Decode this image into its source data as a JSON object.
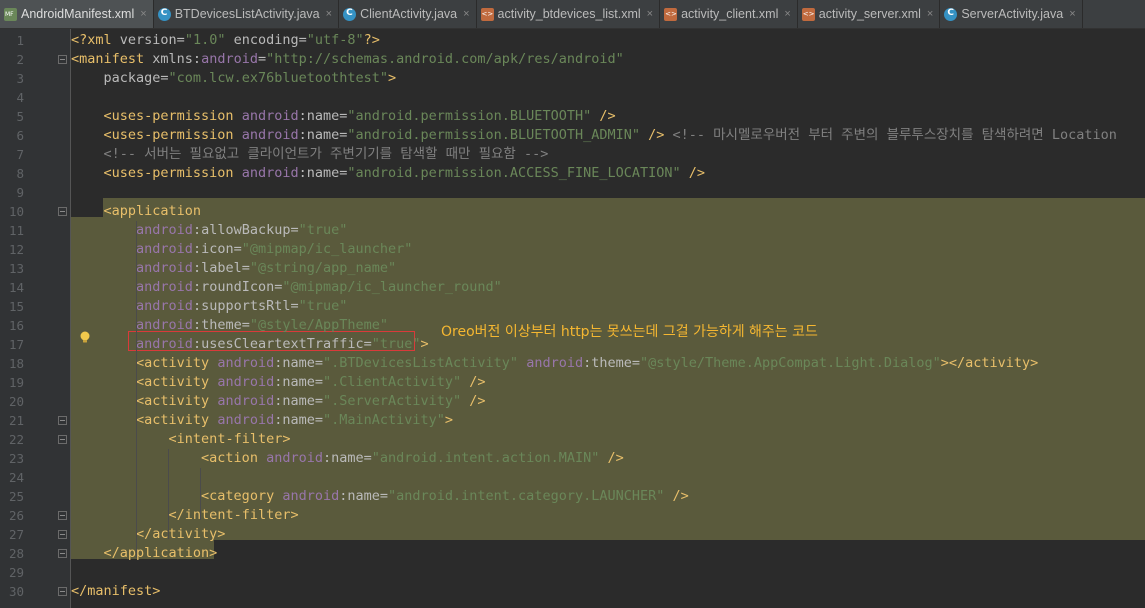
{
  "tabs": [
    {
      "label": "AndroidManifest.xml",
      "type": "manifest",
      "active": true
    },
    {
      "label": "BTDevicesListActivity.java",
      "type": "java",
      "active": false
    },
    {
      "label": "ClientActivity.java",
      "type": "java",
      "active": false
    },
    {
      "label": "activity_btdevices_list.xml",
      "type": "layout",
      "active": false
    },
    {
      "label": "activity_client.xml",
      "type": "layout",
      "active": false
    },
    {
      "label": "activity_server.xml",
      "type": "layout",
      "active": false
    },
    {
      "label": "ServerActivity.java",
      "type": "java",
      "active": false
    }
  ],
  "colors": {
    "background": "#2b2b2b",
    "highlight": "#5a5a3c",
    "annotation": "#f5b731",
    "red_box": "#d93a3a"
  },
  "annotation_text": "Oreo버전 이상부터 http는 못쓰는데 그걸 가능하게 해주는 코드",
  "lines": [
    {
      "n": "1",
      "segments": [
        [
          "tag",
          "<?xml "
        ],
        [
          "attr",
          "version="
        ],
        [
          "val",
          "\"1.0\""
        ],
        [
          "attr",
          " encoding="
        ],
        [
          "val",
          "\"utf-8\""
        ],
        [
          "tag",
          "?>"
        ]
      ]
    },
    {
      "n": "2",
      "segments": [
        [
          "tag",
          "<manifest "
        ],
        [
          "attr",
          "xmlns:"
        ],
        [
          "ns",
          "android"
        ],
        [
          "attr",
          "="
        ],
        [
          "val",
          "\"http://schemas.android.com/apk/res/android\""
        ]
      ]
    },
    {
      "n": "3",
      "segments": [
        [
          "plain",
          "    "
        ],
        [
          "attr",
          "package="
        ],
        [
          "val",
          "\"com.lcw.ex76bluetoothtest\""
        ],
        [
          "tag",
          ">"
        ]
      ]
    },
    {
      "n": "4",
      "segments": []
    },
    {
      "n": "5",
      "segments": [
        [
          "plain",
          "    "
        ],
        [
          "tag",
          "<uses-permission "
        ],
        [
          "ns",
          "android"
        ],
        [
          "attr",
          ":name="
        ],
        [
          "val",
          "\"android.permission.BLUETOOTH\""
        ],
        [
          "tag",
          " />"
        ]
      ]
    },
    {
      "n": "6",
      "segments": [
        [
          "plain",
          "    "
        ],
        [
          "tag",
          "<uses-permission "
        ],
        [
          "ns",
          "android"
        ],
        [
          "attr",
          ":name="
        ],
        [
          "val",
          "\"android.permission.BLUETOOTH_ADMIN\""
        ],
        [
          "tag",
          " />"
        ],
        [
          "cmt",
          " <!-- 마시멜로우버전 부터 주변의 블루투스장치를 탐색하려면 Location"
        ]
      ]
    },
    {
      "n": "7",
      "segments": [
        [
          "cmt",
          "    <!-- 서버는 필요없고 클라이언트가 주변기기를 탐색할 때만 필요함 -->"
        ]
      ]
    },
    {
      "n": "8",
      "segments": [
        [
          "plain",
          "    "
        ],
        [
          "tag",
          "<uses-permission "
        ],
        [
          "ns",
          "android"
        ],
        [
          "attr",
          ":name="
        ],
        [
          "val",
          "\"android.permission.ACCESS_FINE_LOCATION\""
        ],
        [
          "tag",
          " />"
        ]
      ]
    },
    {
      "n": "9",
      "segments": []
    },
    {
      "n": "10",
      "segments": [
        [
          "plain",
          "    "
        ],
        [
          "tag",
          "<application"
        ]
      ]
    },
    {
      "n": "11",
      "segments": [
        [
          "plain",
          "        "
        ],
        [
          "ns",
          "android"
        ],
        [
          "attr",
          ":allowBackup="
        ],
        [
          "val",
          "\"true\""
        ]
      ]
    },
    {
      "n": "12",
      "segments": [
        [
          "plain",
          "        "
        ],
        [
          "ns",
          "android"
        ],
        [
          "attr",
          ":icon="
        ],
        [
          "val",
          "\"@mipmap/ic_launcher\""
        ]
      ]
    },
    {
      "n": "13",
      "segments": [
        [
          "plain",
          "        "
        ],
        [
          "ns",
          "android"
        ],
        [
          "attr",
          ":label="
        ],
        [
          "val",
          "\"@string/app_name\""
        ]
      ]
    },
    {
      "n": "14",
      "segments": [
        [
          "plain",
          "        "
        ],
        [
          "ns",
          "android"
        ],
        [
          "attr",
          ":roundIcon="
        ],
        [
          "val",
          "\"@mipmap/ic_launcher_round\""
        ]
      ]
    },
    {
      "n": "15",
      "segments": [
        [
          "plain",
          "        "
        ],
        [
          "ns",
          "android"
        ],
        [
          "attr",
          ":supportsRtl="
        ],
        [
          "val",
          "\"true\""
        ]
      ]
    },
    {
      "n": "16",
      "segments": [
        [
          "plain",
          "        "
        ],
        [
          "ns",
          "android"
        ],
        [
          "attr",
          ":theme="
        ],
        [
          "val",
          "\"@style/AppTheme\""
        ]
      ]
    },
    {
      "n": "17",
      "segments": [
        [
          "plain",
          "        "
        ],
        [
          "ns",
          "android"
        ],
        [
          "attr",
          ":usesCleartextTraffic="
        ],
        [
          "val",
          "\"true\""
        ],
        [
          "tag",
          ">"
        ]
      ]
    },
    {
      "n": "18",
      "segments": [
        [
          "plain",
          "        "
        ],
        [
          "tag",
          "<activity "
        ],
        [
          "ns",
          "android"
        ],
        [
          "attr",
          ":name="
        ],
        [
          "val",
          "\".BTDevicesListActivity\""
        ],
        [
          "attr",
          " "
        ],
        [
          "ns",
          "android"
        ],
        [
          "attr",
          ":theme="
        ],
        [
          "val",
          "\"@style/Theme.AppCompat.Light.Dialog\""
        ],
        [
          "tag",
          "></activity>"
        ]
      ]
    },
    {
      "n": "19",
      "segments": [
        [
          "plain",
          "        "
        ],
        [
          "tag",
          "<activity "
        ],
        [
          "ns",
          "android"
        ],
        [
          "attr",
          ":name="
        ],
        [
          "val",
          "\".ClientActivity\""
        ],
        [
          "tag",
          " />"
        ]
      ]
    },
    {
      "n": "20",
      "segments": [
        [
          "plain",
          "        "
        ],
        [
          "tag",
          "<activity "
        ],
        [
          "ns",
          "android"
        ],
        [
          "attr",
          ":name="
        ],
        [
          "val",
          "\".ServerActivity\""
        ],
        [
          "tag",
          " />"
        ]
      ]
    },
    {
      "n": "21",
      "segments": [
        [
          "plain",
          "        "
        ],
        [
          "tag",
          "<activity "
        ],
        [
          "ns",
          "android"
        ],
        [
          "attr",
          ":name="
        ],
        [
          "val",
          "\".MainActivity\""
        ],
        [
          "tag",
          ">"
        ]
      ]
    },
    {
      "n": "22",
      "segments": [
        [
          "plain",
          "            "
        ],
        [
          "tag",
          "<intent-filter>"
        ]
      ]
    },
    {
      "n": "23",
      "segments": [
        [
          "plain",
          "                "
        ],
        [
          "tag",
          "<action "
        ],
        [
          "ns",
          "android"
        ],
        [
          "attr",
          ":name="
        ],
        [
          "val",
          "\"android.intent.action.MAIN\""
        ],
        [
          "tag",
          " />"
        ]
      ]
    },
    {
      "n": "24",
      "segments": []
    },
    {
      "n": "25",
      "segments": [
        [
          "plain",
          "                "
        ],
        [
          "tag",
          "<category "
        ],
        [
          "ns",
          "android"
        ],
        [
          "attr",
          ":name="
        ],
        [
          "val",
          "\"android.intent.category.LAUNCHER\""
        ],
        [
          "tag",
          " />"
        ]
      ]
    },
    {
      "n": "26",
      "segments": [
        [
          "plain",
          "            "
        ],
        [
          "tag",
          "</intent-filter>"
        ]
      ]
    },
    {
      "n": "27",
      "segments": [
        [
          "plain",
          "        "
        ],
        [
          "tag",
          "</activity>"
        ]
      ]
    },
    {
      "n": "28",
      "segments": [
        [
          "plain",
          "    "
        ],
        [
          "tag",
          "</application>"
        ]
      ]
    },
    {
      "n": "29",
      "segments": []
    },
    {
      "n": "30",
      "segments": [
        [
          "tag",
          "</manifest>"
        ]
      ]
    }
  ]
}
